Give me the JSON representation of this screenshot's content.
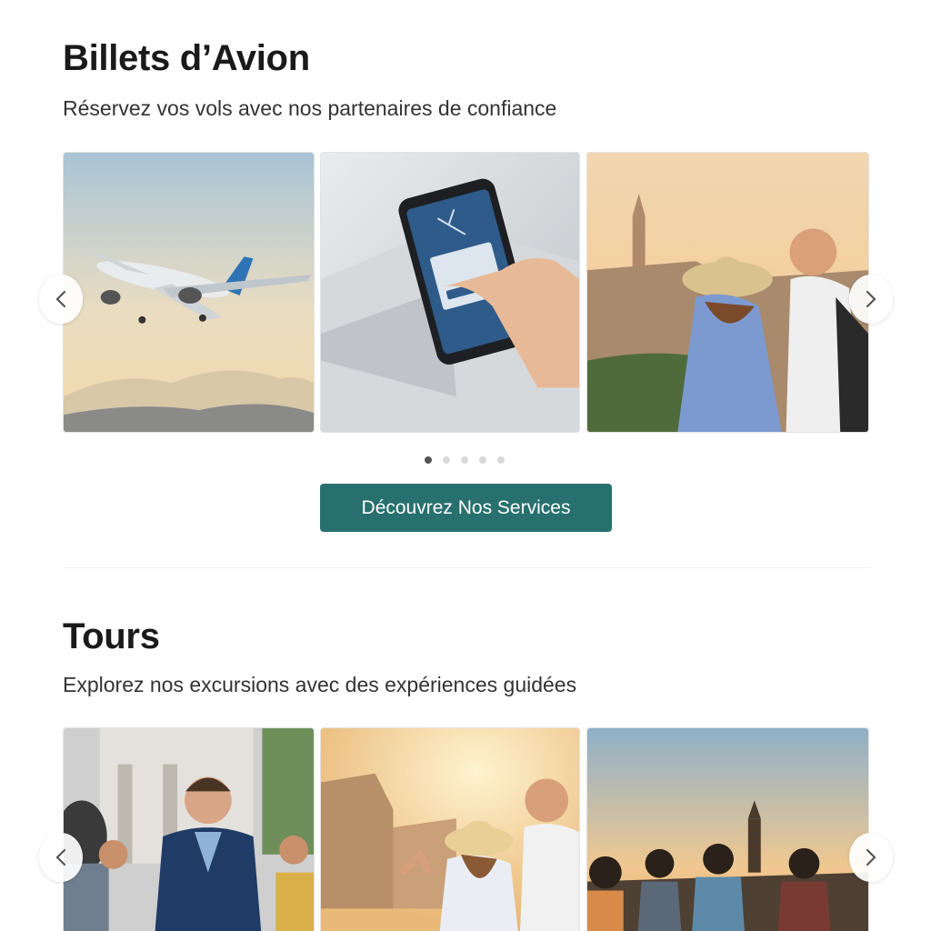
{
  "flights": {
    "title": "Billets d’Avion",
    "subtitle": "Réservez vos vols avec nos partenaires de confiance",
    "slides": [
      {
        "alt": "airplane in sky"
      },
      {
        "alt": "phone booking"
      },
      {
        "alt": "travelers with city view"
      }
    ],
    "dots_count": 5,
    "active_dot": 1,
    "cta_label": "Découvrez Nos Services"
  },
  "tours": {
    "title": "Tours",
    "subtitle": "Explorez nos excursions avec des expériences guidées",
    "slides": [
      {
        "alt": "guide with group"
      },
      {
        "alt": "travelers near colosseum"
      },
      {
        "alt": "group at sunset"
      }
    ]
  },
  "icons": {
    "prev": "chevron-left-icon",
    "next": "chevron-right-icon"
  },
  "colors": {
    "accent": "#27706e",
    "dot_active": "#555555",
    "dot_inactive": "#dadada"
  }
}
